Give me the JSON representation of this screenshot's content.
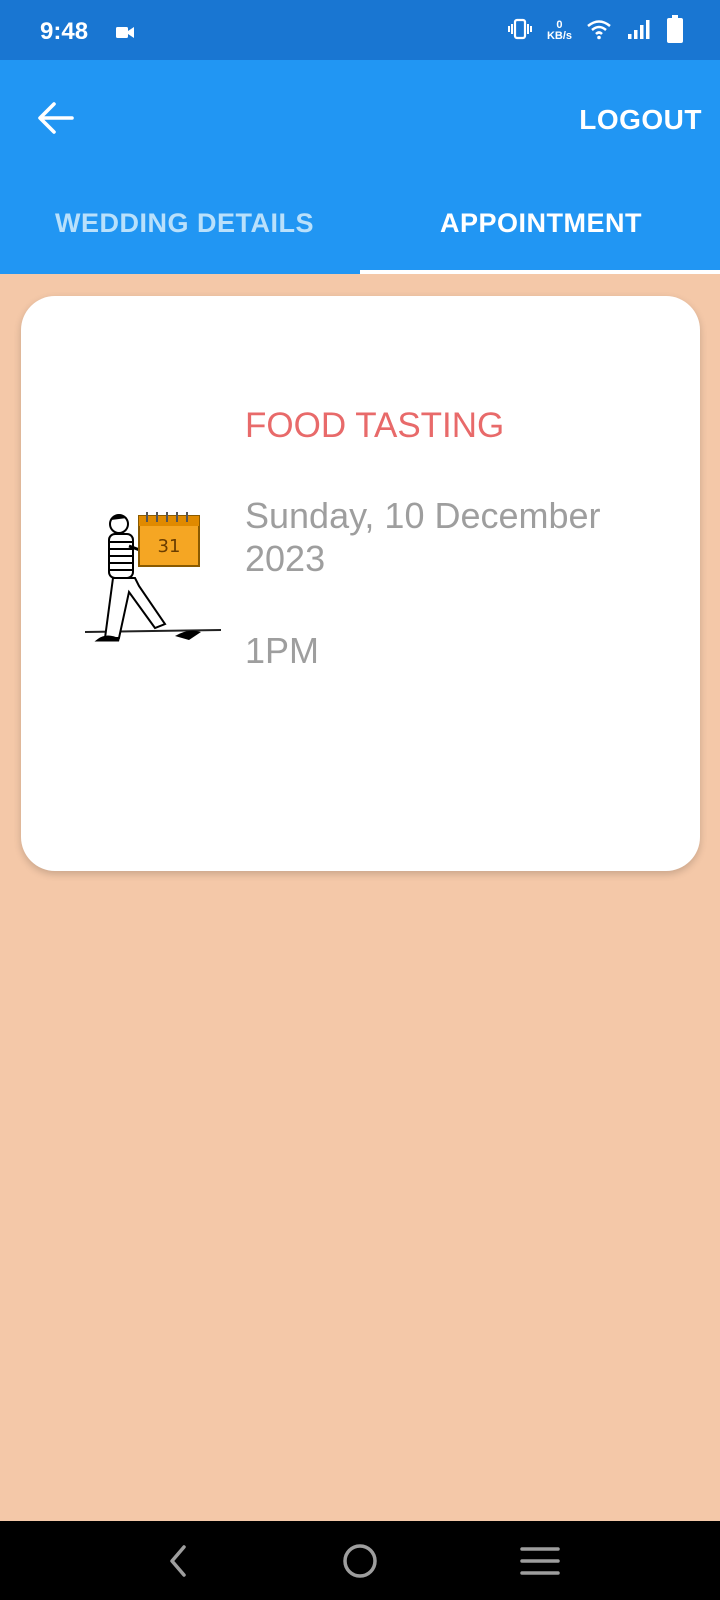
{
  "status_bar": {
    "time": "9:48",
    "net_value": "0",
    "net_unit": "KB/s",
    "icons": [
      "video-camera-icon",
      "vibrate-icon",
      "wifi-icon",
      "signal-icon",
      "battery-icon"
    ]
  },
  "appbar": {
    "logout_label": "LOGOUT",
    "tabs": [
      {
        "label": "WEDDING DETAILS",
        "selected": false
      },
      {
        "label": "APPOINTMENT",
        "selected": true
      }
    ]
  },
  "appointment": {
    "title": "FOOD TASTING",
    "date": "Sunday, 10 December 2023",
    "time": "1PM"
  },
  "nav": {
    "icons": [
      "back-nav-icon",
      "home-nav-icon",
      "menu-nav-icon"
    ]
  },
  "colors": {
    "status_bar": "#1976D2",
    "appbar": "#2196F3",
    "background": "#F4C8A8",
    "title": "#E86A6A",
    "secondary_text": "#9E9E9E"
  }
}
